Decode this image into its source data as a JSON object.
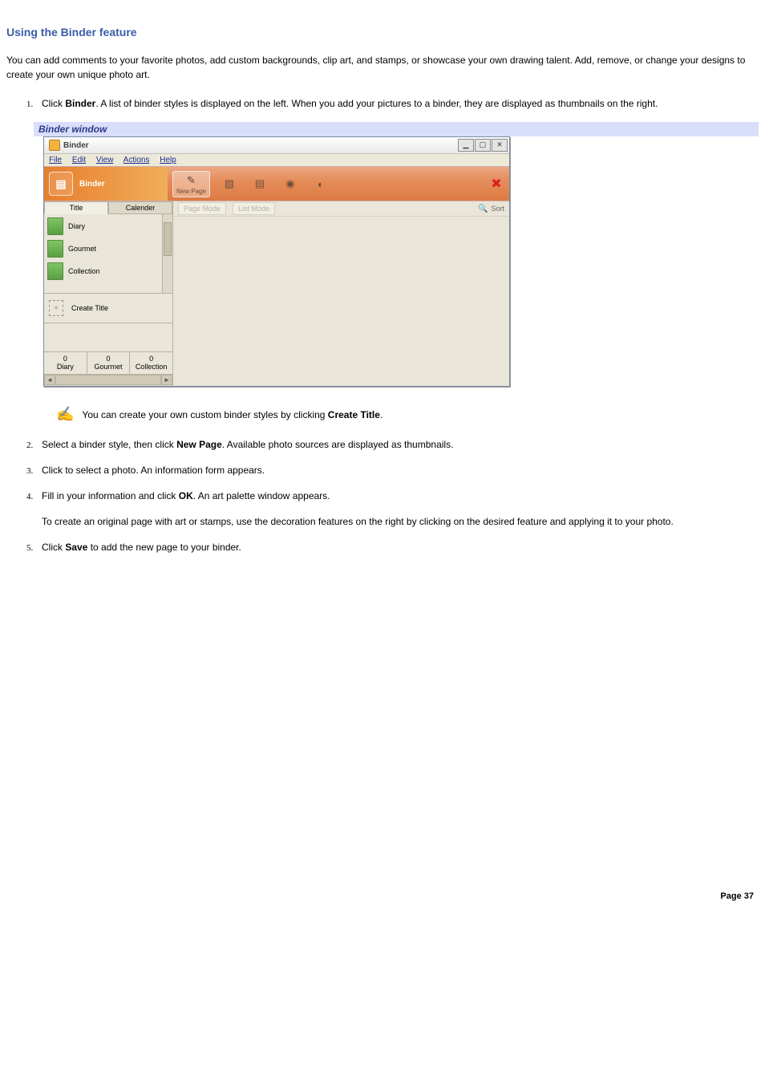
{
  "page": {
    "title": "Using the Binder feature",
    "intro": "You can add comments to your favorite photos, add custom backgrounds, clip art, and stamps, or showcase your own drawing talent. Add, remove, or change your designs to create your own unique photo art.",
    "footer": "Page 37"
  },
  "steps": {
    "s1_prefix": "Click ",
    "s1_bold": "Binder",
    "s1_suffix": ". A list of binder styles is displayed on the left. When you add your pictures to a binder, they are displayed as thumbnails on the right.",
    "s2_prefix": "Select a binder style, then click ",
    "s2_bold": "New Page",
    "s2_suffix": ". Available photo sources are displayed as thumbnails.",
    "s3": "Click to select a photo. An information form appears.",
    "s4_prefix": "Fill in your information and click ",
    "s4_bold": "OK",
    "s4_suffix": ". An art palette window appears.",
    "s4_p2": "To create an original page with art or stamps, use the decoration features on the right by clicking on the desired feature and applying it to your photo.",
    "s5_prefix": "Click ",
    "s5_bold": "Save",
    "s5_suffix": " to add the new page to your binder."
  },
  "caption": "Binder window",
  "note": {
    "prefix": "You can create your own custom binder styles by clicking ",
    "bold": "Create Title",
    "suffix": "."
  },
  "window": {
    "title": "Binder",
    "win_min": "▁",
    "win_max": "▢",
    "win_close": "✕",
    "menus": [
      "File",
      "Edit",
      "View",
      "Actions",
      "Help"
    ],
    "header_label": "Binder",
    "toolbar": {
      "new_page": "New Page"
    },
    "sidebar": {
      "tab_title": "Title",
      "tab_calendar": "Calender",
      "styles": [
        "Diary",
        "Gourmet",
        "Collection"
      ],
      "create_title": "Create Title",
      "counts": [
        {
          "n": "0",
          "label": "Diary"
        },
        {
          "n": "0",
          "label": "Gourmet"
        },
        {
          "n": "0",
          "label": "Collection"
        }
      ]
    },
    "main": {
      "page_mode": "Page Mode",
      "list_mode": "List Mode",
      "sort": "Sort"
    }
  }
}
